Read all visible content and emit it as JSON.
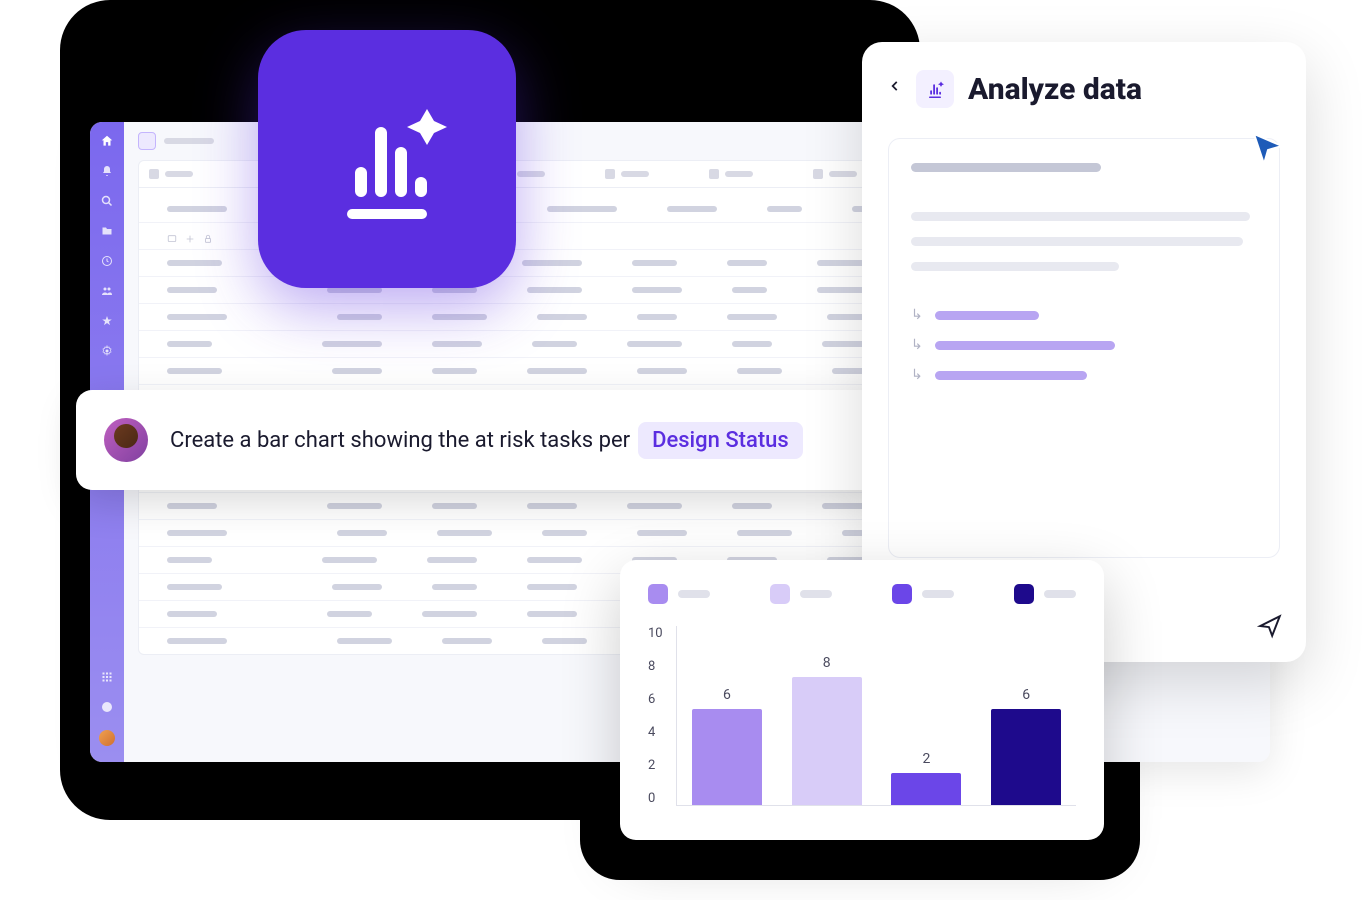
{
  "colors": {
    "primary": "#5b2ee0",
    "bar1": "#a88cf0",
    "bar2": "#d8ccf8",
    "bar3": "#6b46e8",
    "bar4": "#1e0a8c"
  },
  "prompt": {
    "text_before": "Create a bar chart showing the at risk tasks per",
    "tag_label": "Design Status"
  },
  "analyze": {
    "title": "Analyze data"
  },
  "chart_data": {
    "type": "bar",
    "categories": [
      "",
      "",
      "",
      ""
    ],
    "series": [
      {
        "name": "",
        "color": "#a88cf0",
        "value": 6
      },
      {
        "name": "",
        "color": "#d8ccf8",
        "value": 8
      },
      {
        "name": "",
        "color": "#6b46e8",
        "value": 2
      },
      {
        "name": "",
        "color": "#1e0a8c",
        "value": 6
      }
    ],
    "y_ticks": [
      10,
      8,
      6,
      4,
      2,
      0
    ],
    "ylim": [
      0,
      10
    ],
    "title": "",
    "xlabel": "",
    "ylabel": ""
  }
}
